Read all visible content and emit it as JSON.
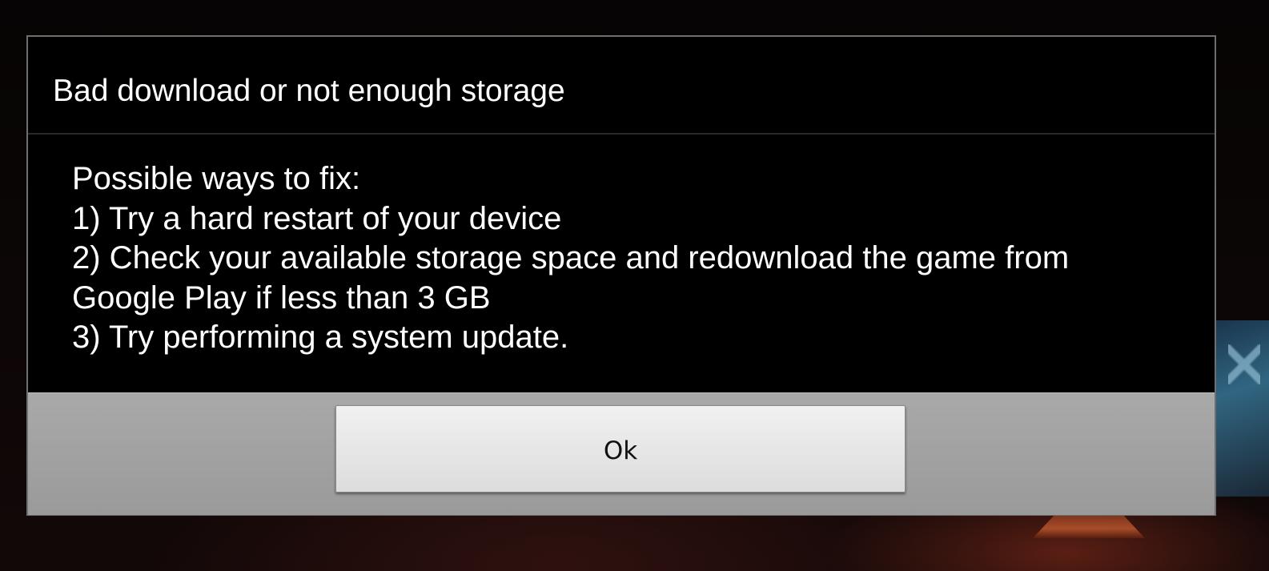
{
  "dialog": {
    "title": "Bad download or not enough storage",
    "message_lines": [
      "Possible ways to fix:",
      "1) Try a hard restart of your device",
      "2) Check your available storage space and redownload the game from",
      "Google Play if less than 3 GB",
      "3) Try performing a system update."
    ],
    "ok_label": "Ok"
  },
  "colors": {
    "dialog_background": "#000000",
    "button_bar": "#a0a0a0",
    "button_face": "#e8e8e8",
    "text_primary": "#ffffff"
  }
}
